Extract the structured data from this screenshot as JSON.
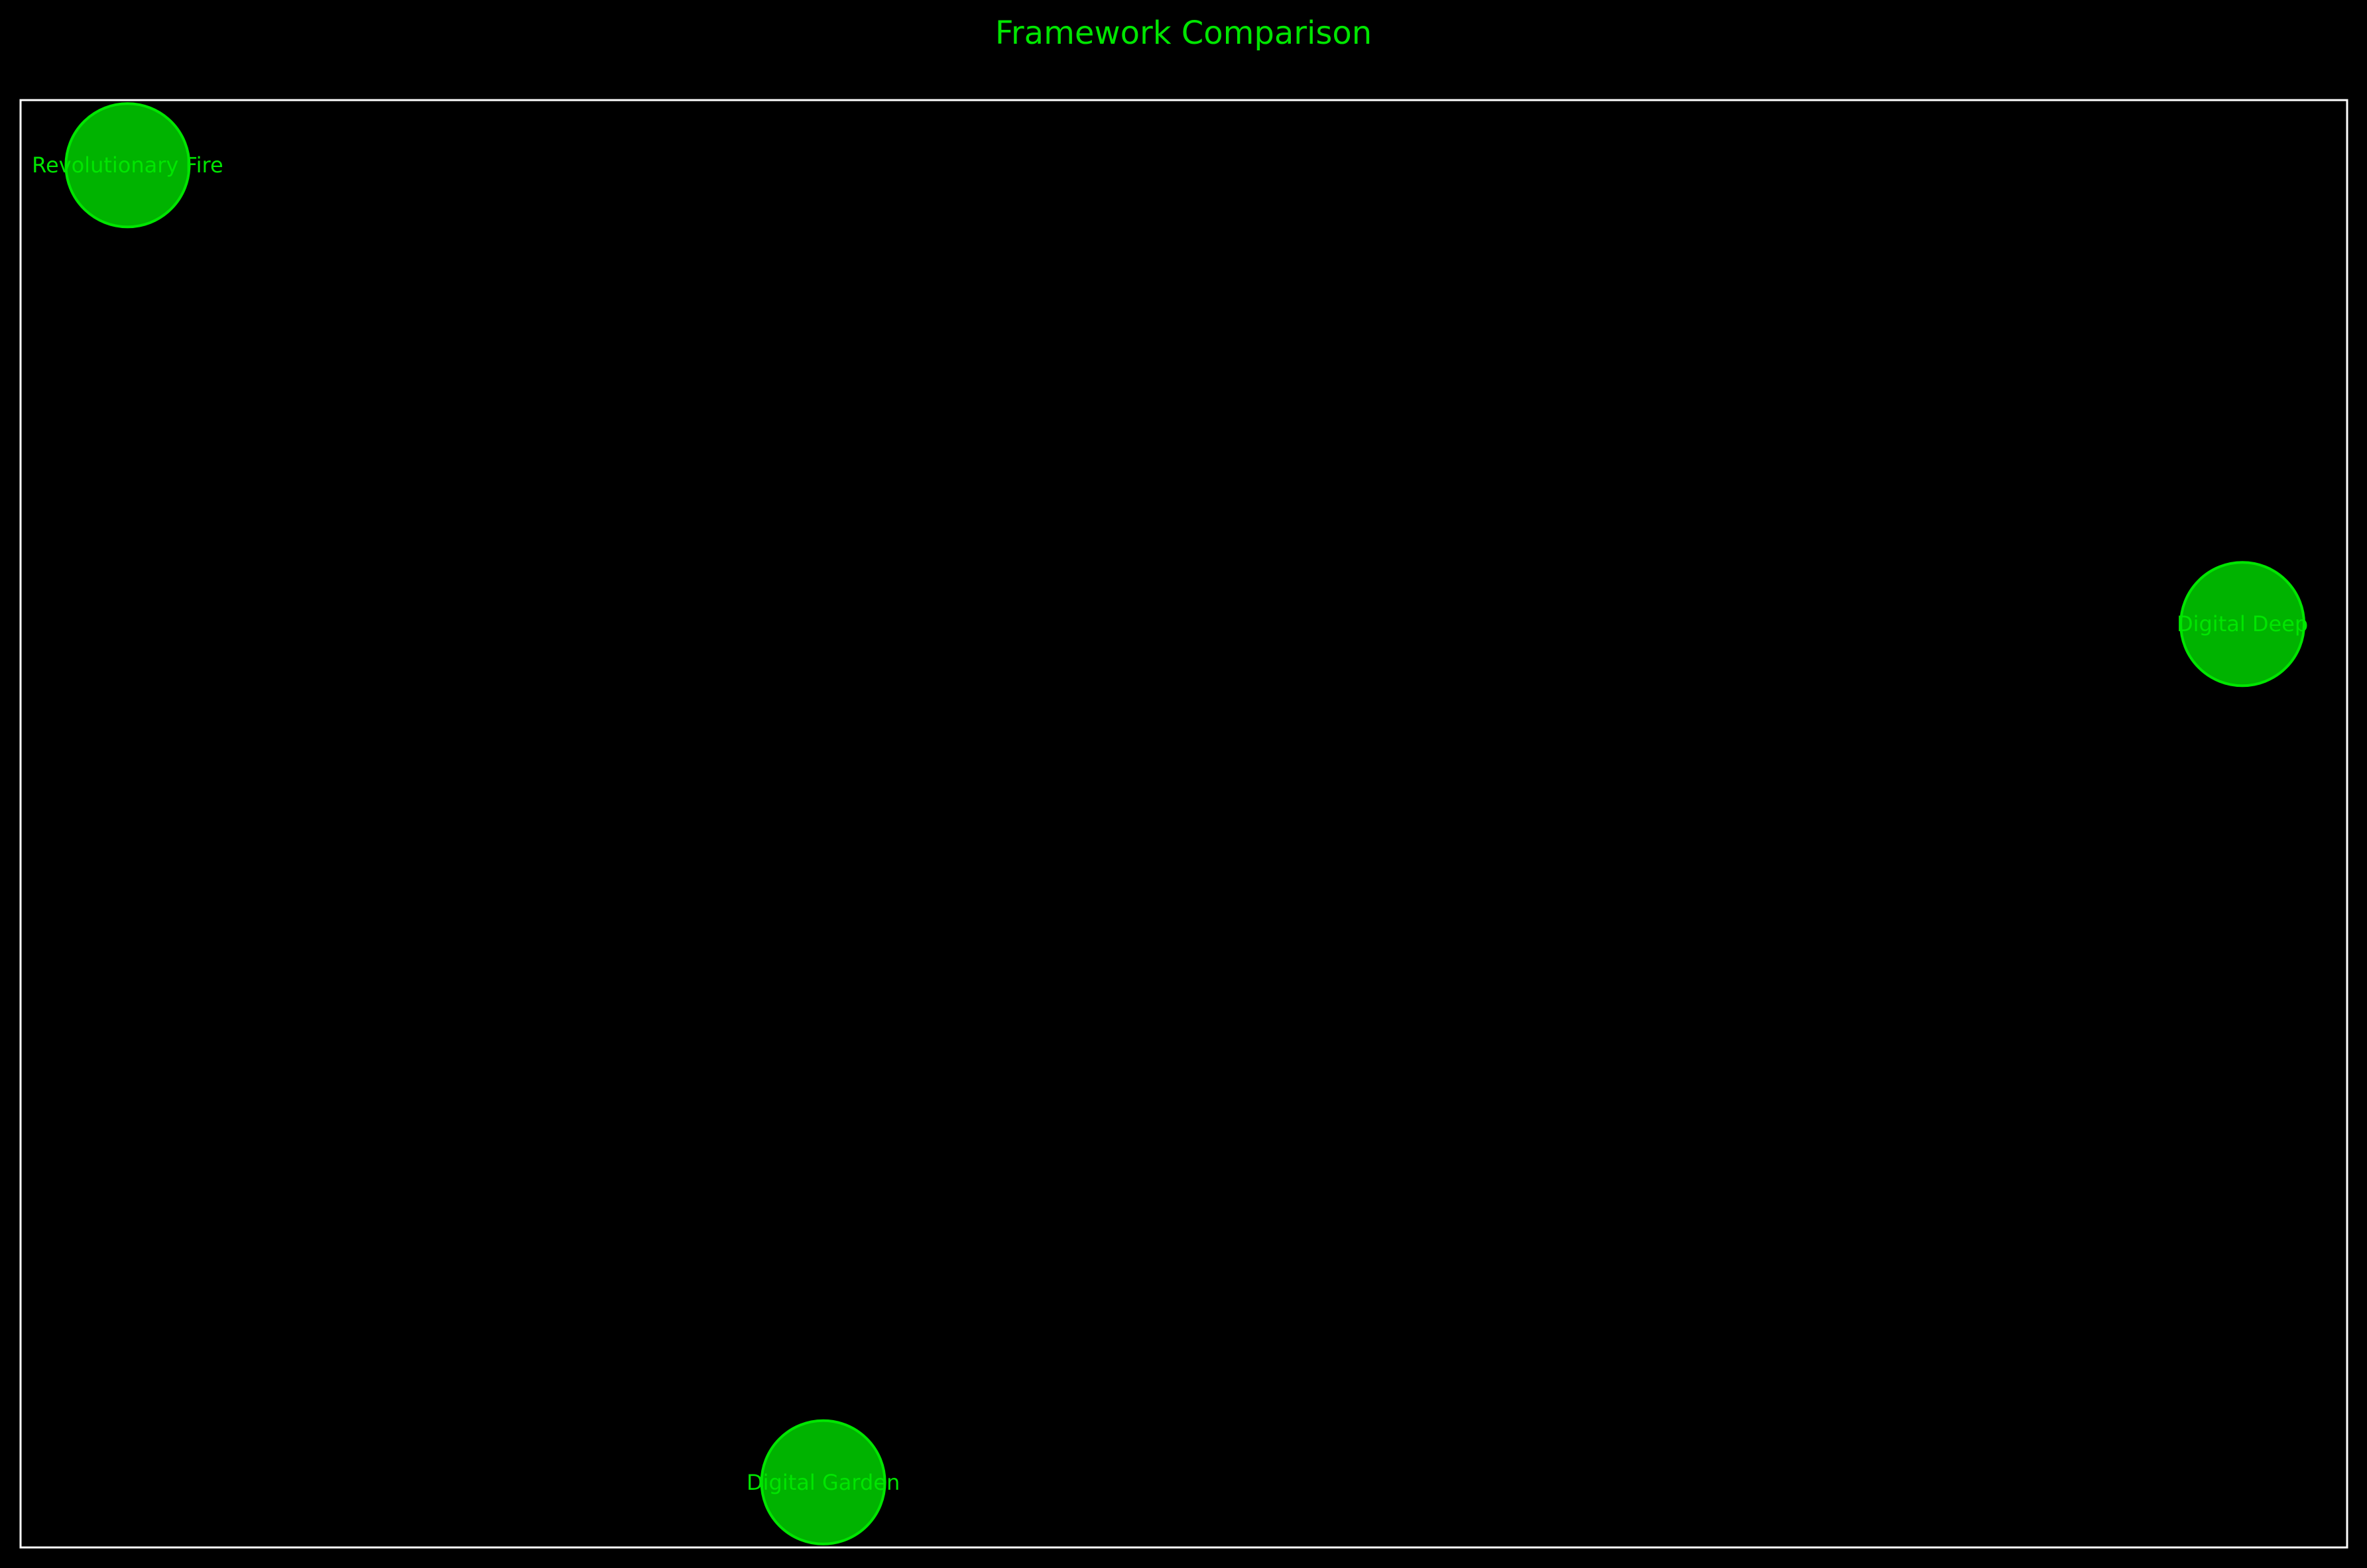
{
  "chart_data": {
    "type": "scatter",
    "title": "Framework Comparison",
    "xlabel": "",
    "ylabel": "",
    "grid": false,
    "axes_visible": false,
    "points": [
      {
        "label": "Revolutionary Fire",
        "x": 0.046,
        "y": 0.955
      },
      {
        "label": "Digital Deep",
        "x": 0.955,
        "y": 0.638
      },
      {
        "label": "Digital Garden",
        "x": 0.345,
        "y": 0.045
      }
    ]
  },
  "colors": {
    "background": "#000000",
    "frame": "#ffffff",
    "title": "#00e600",
    "marker_fill": "#00b300",
    "marker_edge": "#00e600",
    "label": "#00e600"
  }
}
